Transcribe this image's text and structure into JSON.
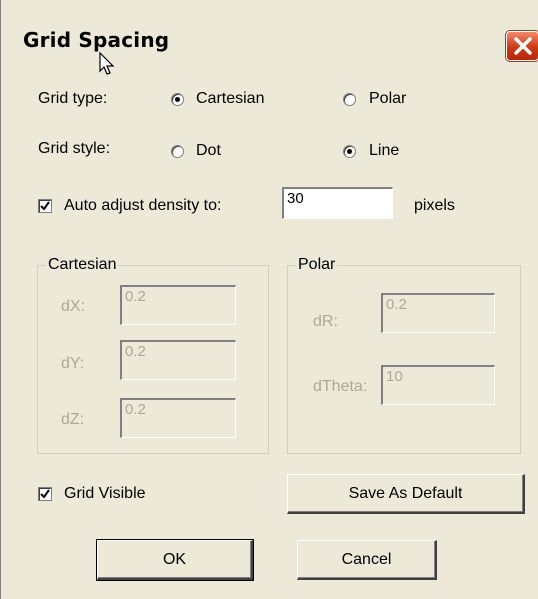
{
  "window": {
    "title": "Grid Spacing"
  },
  "grid_type": {
    "label": "Grid type:",
    "options": [
      "Cartesian",
      "Polar"
    ],
    "selected": "Cartesian"
  },
  "grid_style": {
    "label": "Grid style:",
    "options": [
      "Dot",
      "Line"
    ],
    "selected": "Line"
  },
  "auto_adjust": {
    "label": "Auto adjust density to:",
    "checked": true,
    "value": "30",
    "unit": "pixels"
  },
  "cartesian": {
    "title": "Cartesian",
    "dx": {
      "label": "dX:",
      "value": "0.2"
    },
    "dy": {
      "label": "dY:",
      "value": "0.2"
    },
    "dz": {
      "label": "dZ:",
      "value": "0.2"
    }
  },
  "polar": {
    "title": "Polar",
    "dr": {
      "label": "dR:",
      "value": "0.2"
    },
    "dtheta": {
      "label": "dTheta:",
      "value": "10"
    }
  },
  "grid_visible": {
    "label": "Grid Visible",
    "checked": true
  },
  "buttons": {
    "save_default": "Save As Default",
    "ok": "OK",
    "cancel": "Cancel"
  },
  "icons": {
    "close": "close-x-icon",
    "cursor": "mouse-pointer-icon"
  },
  "colors": {
    "close_red": "#cc3a14",
    "face": "#ece9d8",
    "disabled_text": "#aca899"
  }
}
